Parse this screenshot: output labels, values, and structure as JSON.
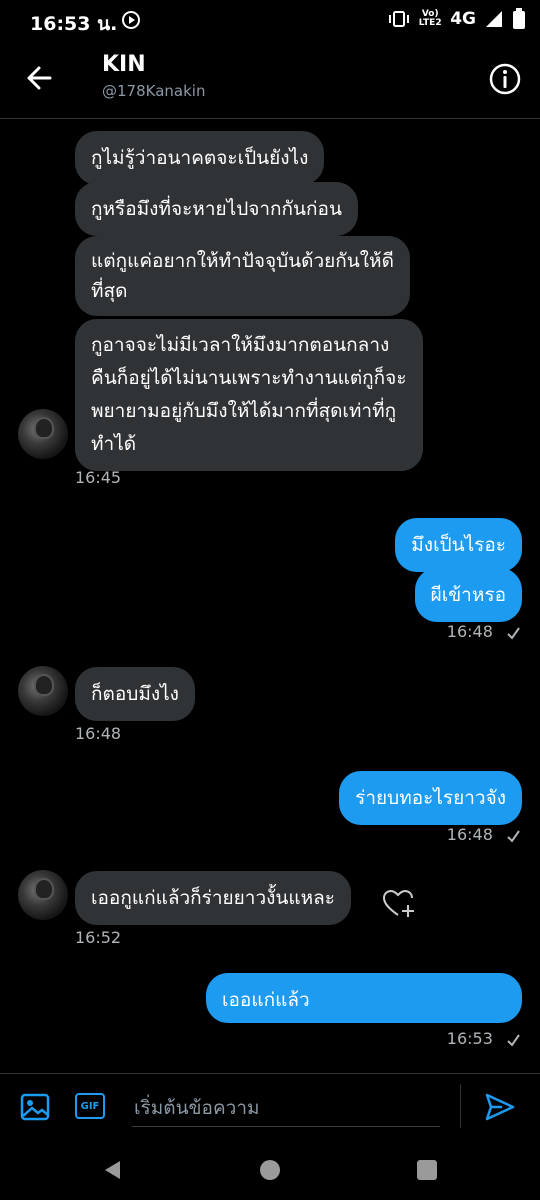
{
  "status_bar": {
    "time": "16:53 น.",
    "network": "4G",
    "lte_label": "Vo) LTE2"
  },
  "header": {
    "name": "KIN",
    "handle": "@178Kanakin"
  },
  "messages": {
    "m1": "กูไม่รู้ว่าอนาคตจะเป็นยังไง",
    "m2": "กูหรือมึงที่จะหายไปจากกันก่อน",
    "m3": "แต่กูแค่อยากให้ทำปัจจุบันด้วยกันให้ดี\nที่สุด",
    "m4": "กูอาจจะไม่มีเวลาให้มึงมากตอนกลาง\nคืนก็อยู่ได้ไม่นานเพราะทำงานแต่กูก็จะ\nพยายามอยู่กับมึงให้ได้มากที่สุดเท่าที่กู\nทำได้",
    "t1": "16:45",
    "m5": "มึงเป็นไรอะ",
    "m6": "ผีเข้าหรอ",
    "t2": "16:48",
    "m7": "ก็ตอบมึงไง",
    "t3": "16:48",
    "m8": "ร่ายบทอะไรยาวจัง",
    "t4": "16:48",
    "m9": "เออกูแก่แล้วก็ร่ายยาวงั้นแหละ",
    "t5": "16:52",
    "m10": "เออแก่แล้ว",
    "t6": "16:53"
  },
  "composer": {
    "placeholder": "เริ่มต้นข้อความ",
    "gif_label": "GIF"
  },
  "colors": {
    "accent": "#1d9bf0",
    "incoming_bubble": "#2f3336",
    "background": "#000000"
  }
}
